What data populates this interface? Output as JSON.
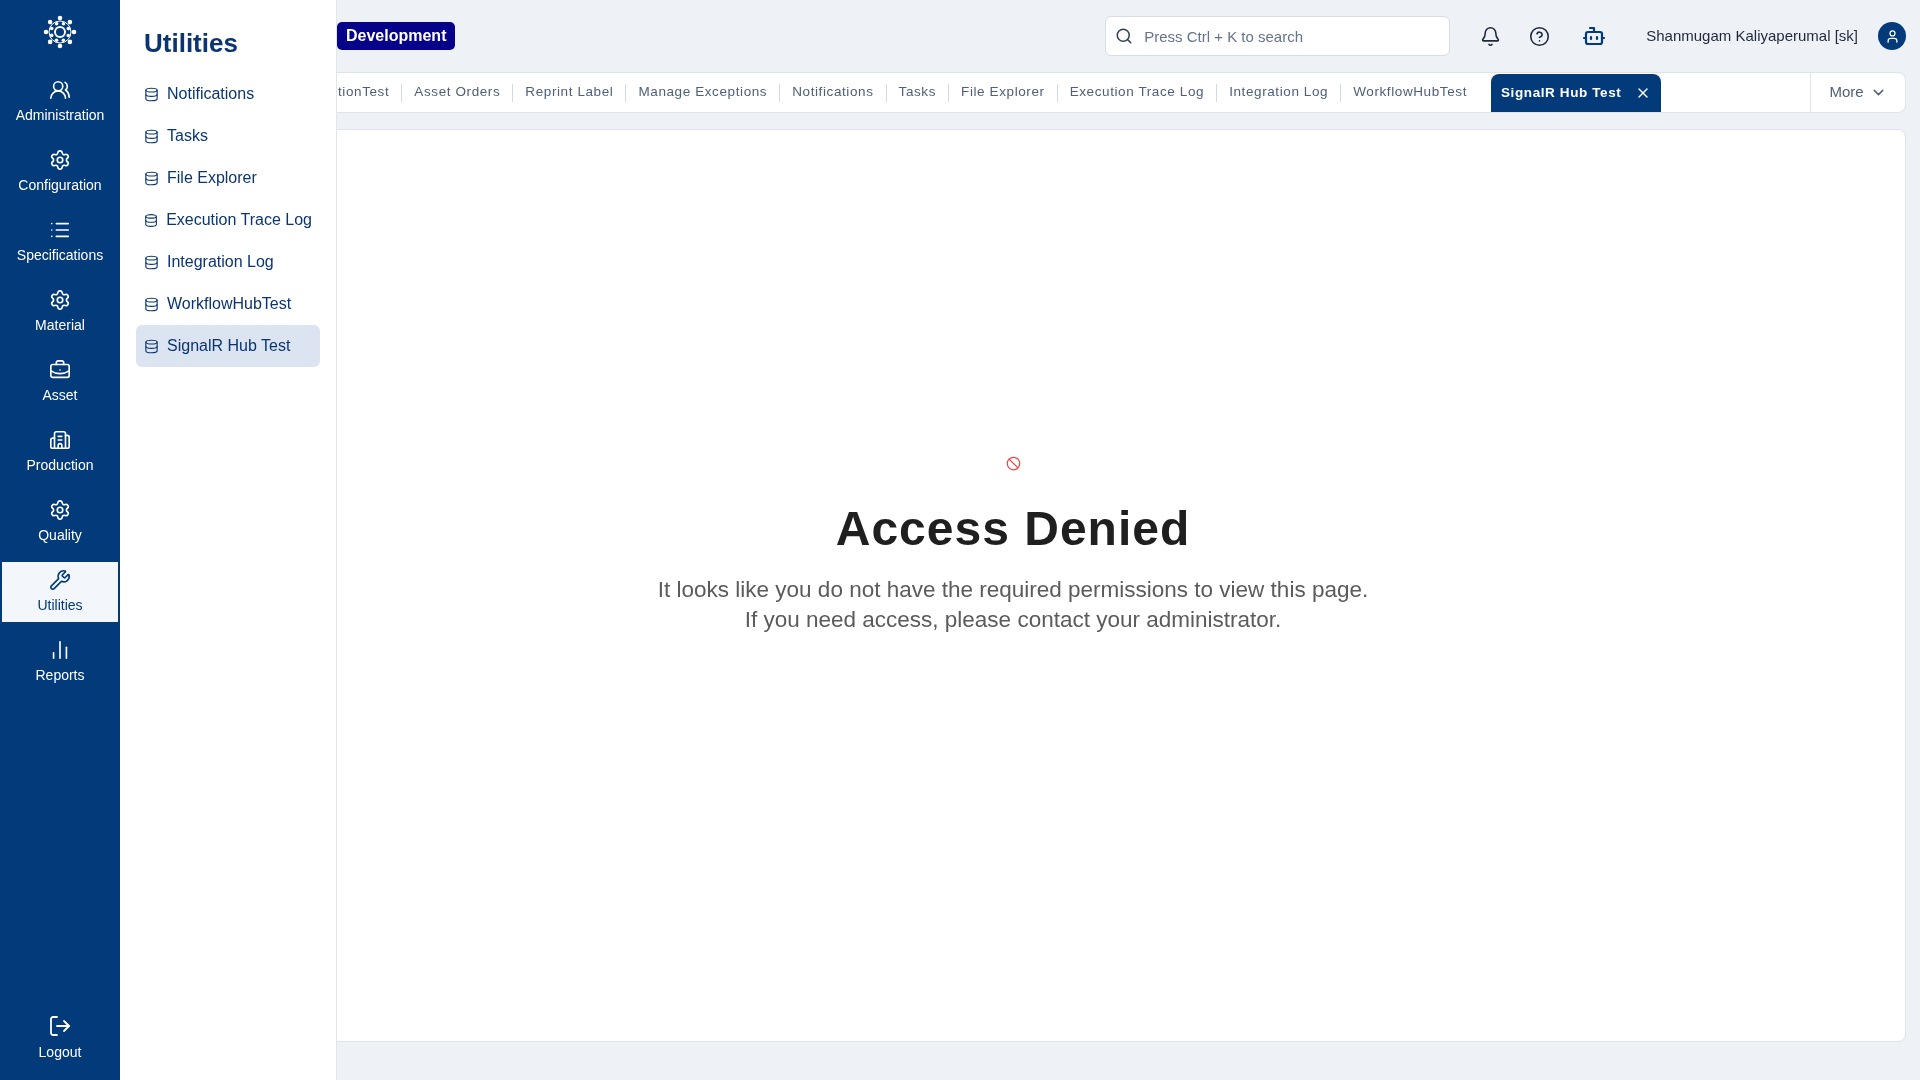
{
  "nav": {
    "items": [
      {
        "label": "Administration",
        "selected": false
      },
      {
        "label": "Configuration",
        "selected": false
      },
      {
        "label": "Specifications",
        "selected": false
      },
      {
        "label": "Material",
        "selected": false
      },
      {
        "label": "Asset",
        "selected": false
      },
      {
        "label": "Production",
        "selected": false
      },
      {
        "label": "Quality",
        "selected": false
      },
      {
        "label": "Utilities",
        "selected": true
      },
      {
        "label": "Reports",
        "selected": false
      }
    ],
    "logout": "Logout"
  },
  "flyout": {
    "title": "Utilities",
    "items": [
      {
        "label": "Notifications",
        "selected": false
      },
      {
        "label": "Tasks",
        "selected": false
      },
      {
        "label": "File Explorer",
        "selected": false
      },
      {
        "label": "Execution Trace Log",
        "selected": false
      },
      {
        "label": "Integration Log",
        "selected": false
      },
      {
        "label": "WorkflowHubTest",
        "selected": false
      },
      {
        "label": "SignalR Hub Test",
        "selected": true
      }
    ]
  },
  "topbar": {
    "environment": "Development",
    "search": {
      "placeholder": "Press Ctrl + K to search"
    },
    "user": "Shanmugam Kaliyaperumal [sk]"
  },
  "tabs": {
    "items": [
      {
        "label": "tionTest",
        "selected": false
      },
      {
        "label": "Asset Orders",
        "selected": false
      },
      {
        "label": "Reprint Label",
        "selected": false
      },
      {
        "label": "Manage Exceptions",
        "selected": false
      },
      {
        "label": "Notifications",
        "selected": false
      },
      {
        "label": "Tasks",
        "selected": false
      },
      {
        "label": "File Explorer",
        "selected": false
      },
      {
        "label": "Execution Trace Log",
        "selected": false
      },
      {
        "label": "Integration Log",
        "selected": false
      },
      {
        "label": "WorkflowHubTest",
        "selected": false
      },
      {
        "label": "SignalR Hub Test",
        "selected": true
      }
    ],
    "more": "More"
  },
  "content": {
    "title": "Access Denied",
    "message": [
      "It looks like you do not have the required permissions to view this page.",
      "If you need access, please contact your administrator."
    ]
  }
}
